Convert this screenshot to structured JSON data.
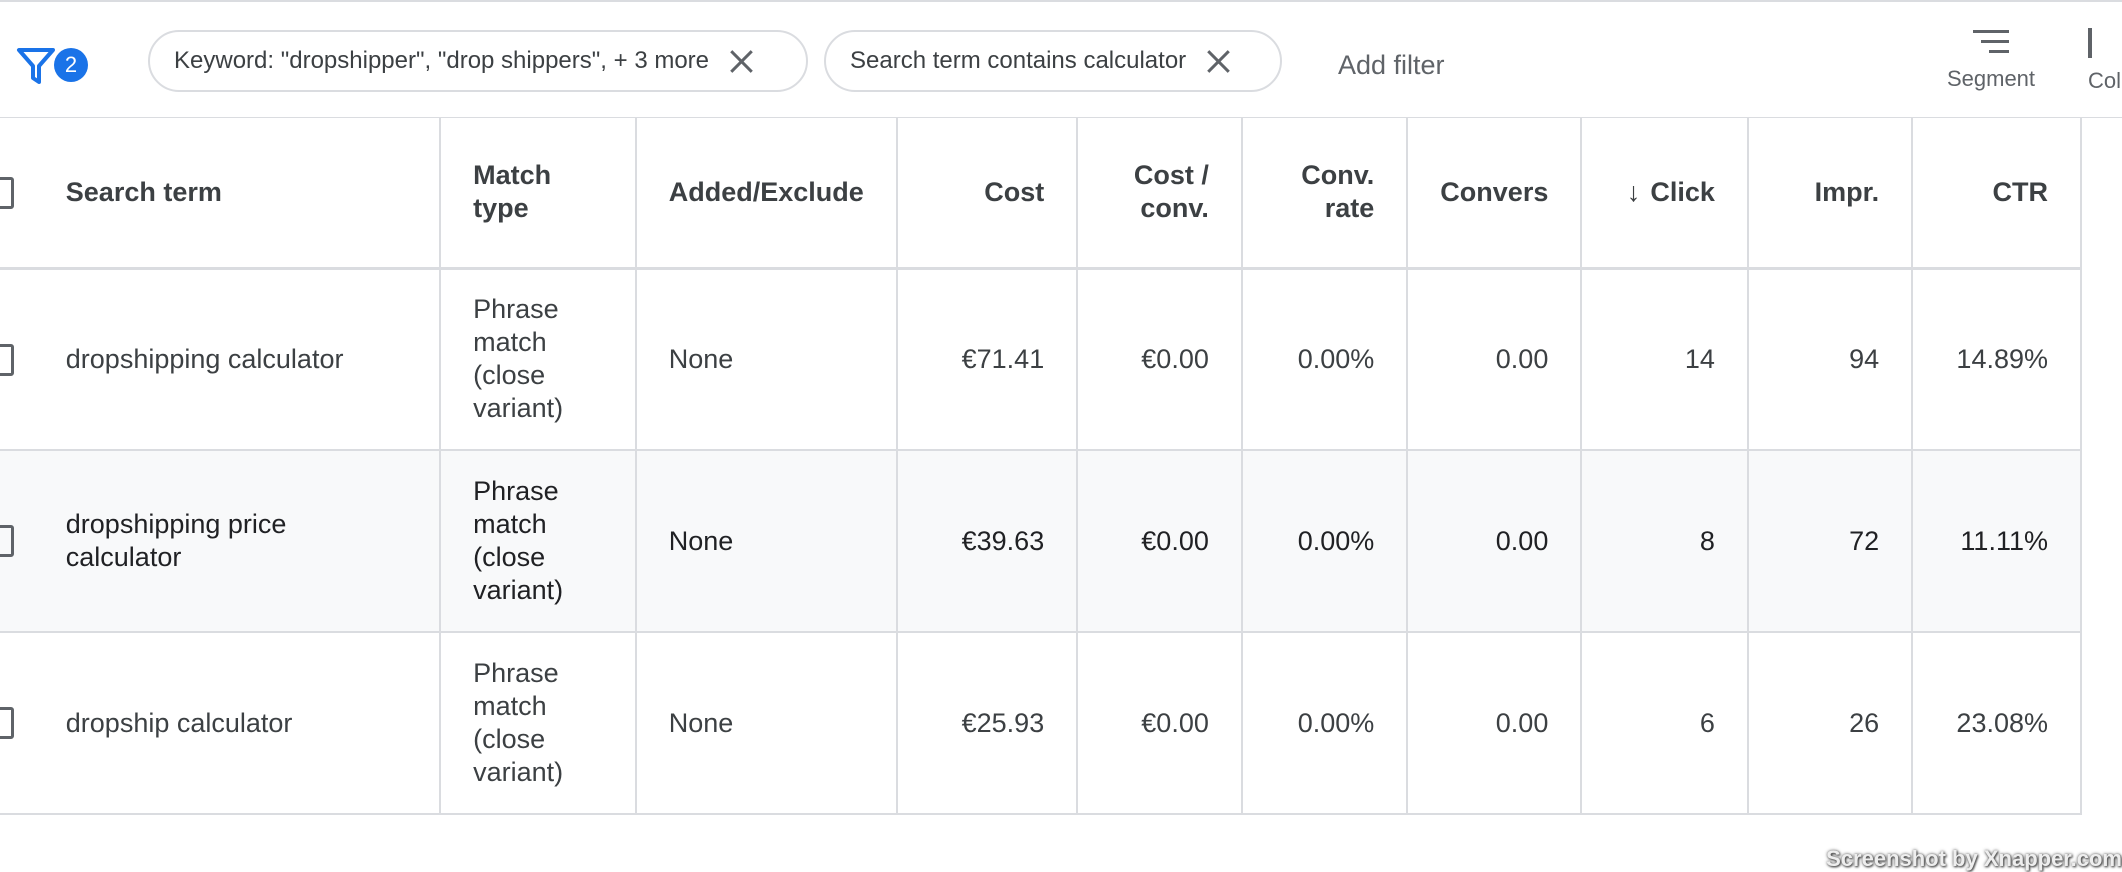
{
  "toolbar": {
    "filter_count": "2",
    "chips": [
      {
        "label": "Keyword: \"dropshipper\", \"drop shippers\", + 3 more"
      },
      {
        "label": "Search term contains calculator"
      }
    ],
    "add_filter_label": "Add filter",
    "segment_label": "Segment",
    "columns_label": "Col"
  },
  "table": {
    "headers": {
      "search_term": "Search term",
      "match_type": "Match type",
      "added_excluded": "Added/Exclude",
      "cost": "Cost",
      "cost_conv": "Cost / conv.",
      "conv_rate": "Conv. rate",
      "conversions": "Convers",
      "clicks": "Click",
      "impr": "Impr.",
      "ctr": "CTR"
    },
    "sort_arrow": "↓",
    "rows": [
      {
        "search_term": "dropshipping calculator",
        "match_type": "Phrase match (close variant)",
        "added_excluded": "None",
        "cost": "€71.41",
        "cost_conv": "€0.00",
        "conv_rate": "0.00%",
        "conversions": "0.00",
        "clicks": "14",
        "impr": "94",
        "ctr": "14.89%"
      },
      {
        "search_term": "dropshipping price calculator",
        "match_type": "Phrase match (close variant)",
        "added_excluded": "None",
        "cost": "€39.63",
        "cost_conv": "€0.00",
        "conv_rate": "0.00%",
        "conversions": "0.00",
        "clicks": "8",
        "impr": "72",
        "ctr": "11.11%"
      },
      {
        "search_term": "dropship calculator",
        "match_type": "Phrase match (close variant)",
        "added_excluded": "None",
        "cost": "€25.93",
        "cost_conv": "€0.00",
        "conv_rate": "0.00%",
        "conversions": "0.00",
        "clicks": "6",
        "impr": "26",
        "ctr": "23.08%"
      }
    ]
  },
  "watermark": "Screenshot by Xnapper.com",
  "colors": {
    "accent": "#1a73e8",
    "border": "#dadce0",
    "text": "#3c4043",
    "row_alt": "#f8f9fa"
  }
}
